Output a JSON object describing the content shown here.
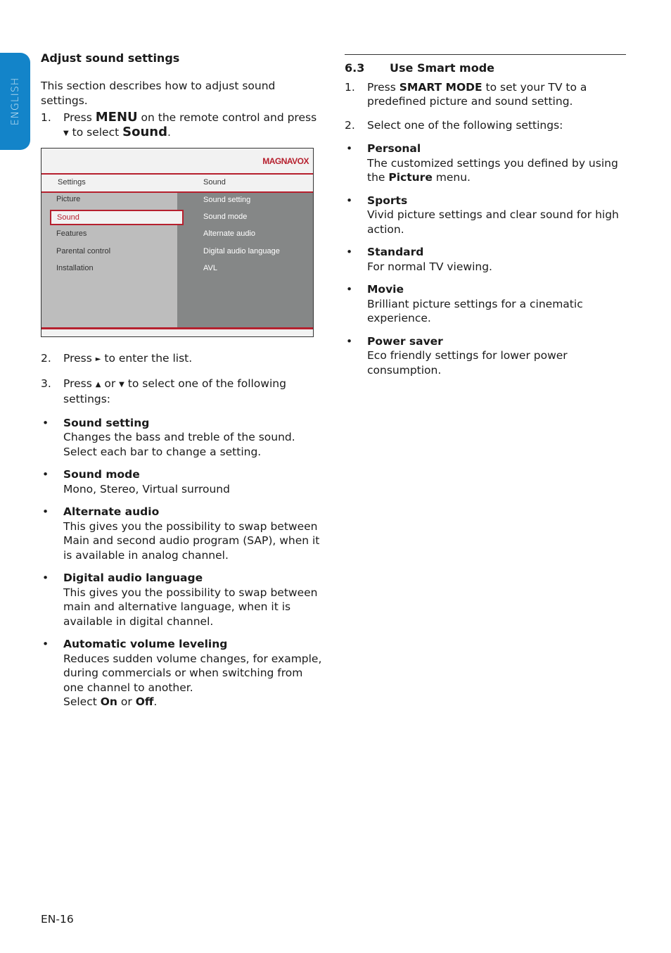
{
  "side_tab": {
    "label": "ENGLISH",
    "color": "#1384c9"
  },
  "left": {
    "heading": "Adjust sound settings",
    "intro": "This section describes how to adjust sound settings.",
    "step1": {
      "num": "1.",
      "pre": "Press ",
      "key": "MENU",
      "mid": " on the remote control and press",
      "arrow": "▼",
      "post1": " to select ",
      "target": "Sound",
      "end": "."
    },
    "tv_menu": {
      "brand": "MAGNAVOX",
      "header_left": "Settings",
      "header_right": "Sound",
      "left_items": [
        "Picture",
        "Sound",
        "Features",
        "Parental control",
        "Installation"
      ],
      "selected_item": "Sound",
      "right_items": [
        "Sound setting",
        "Sound mode",
        "Alternate audio",
        "Digital audio language",
        "AVL"
      ],
      "accent": "#b6202e"
    },
    "step2": {
      "num": "2.",
      "pre": "Press ",
      "arrow": "►",
      "post": " to enter the list."
    },
    "step3": {
      "num": "3.",
      "pre": "Press ",
      "arrow_up": "▲",
      "mid": " or ",
      "arrow_down": "▼",
      "post": " to select one of the following settings:"
    },
    "bullets": [
      {
        "title": "Sound setting",
        "desc": "Changes the bass and treble of the sound. Select each bar to change a setting."
      },
      {
        "title": "Sound mode",
        "desc": "Mono, Stereo, Virtual surround"
      },
      {
        "title": "Alternate audio",
        "desc": "This gives you the possibility to swap between Main and second audio program (SAP), when it is available in analog channel."
      },
      {
        "title": "Digital audio language",
        "desc": "This gives you the possibility to swap between main and alternative language, when it is available in digital channel."
      },
      {
        "title": "Automatic volume leveling",
        "desc": "Reduces sudden volume changes, for example, during commercials or when switching from one channel to another.",
        "select_pre": "Select ",
        "on": "On",
        "or": " or ",
        "off": "Off",
        "end": "."
      }
    ]
  },
  "right": {
    "section_num": "6.3",
    "section_title": "Use Smart mode",
    "step1": {
      "num": "1.",
      "pre": "Press ",
      "key": "SMART MODE",
      "post": " to set your TV to a predefined picture and sound setting."
    },
    "step2": {
      "num": "2.",
      "text": "Select one of the following settings:"
    },
    "bullets": [
      {
        "title": "Personal",
        "desc_pre": "The customized settings you defined by using the ",
        "desc_bold": "Picture",
        "desc_post": " menu."
      },
      {
        "title": "Sports",
        "desc": "Vivid picture settings and clear sound for high action."
      },
      {
        "title": "Standard",
        "desc": "For normal TV viewing."
      },
      {
        "title": "Movie",
        "desc": "Brilliant picture settings for a cinematic experience."
      },
      {
        "title": "Power saver",
        "desc": "Eco friendly settings for lower power consumption."
      }
    ]
  },
  "footer": {
    "page": "EN-16"
  },
  "bullet_glyph": "•"
}
